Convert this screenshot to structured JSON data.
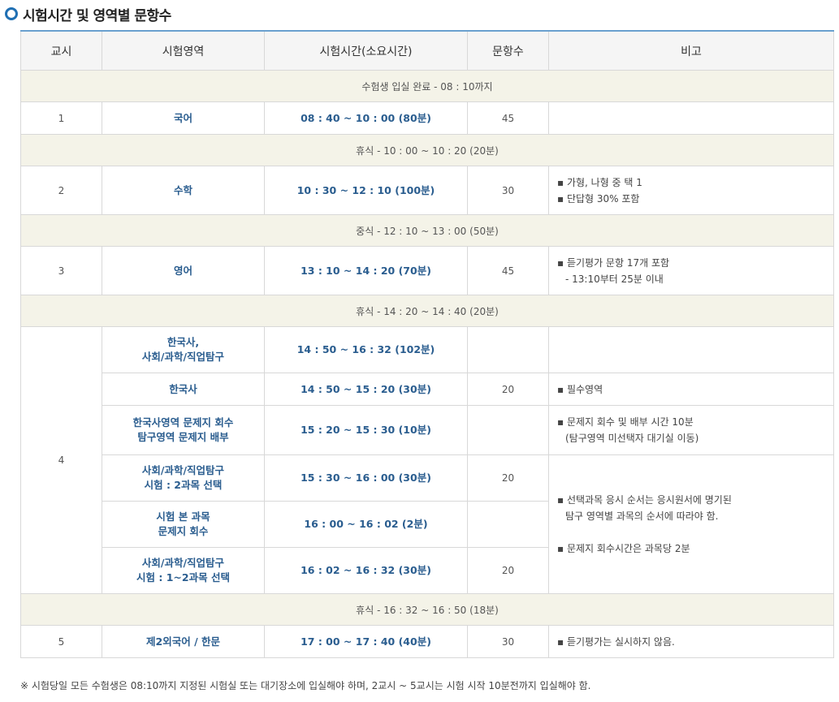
{
  "title": "시험시간 및 영역별 문항수",
  "columns": [
    "교시",
    "시험영역",
    "시험시간(소요시간)",
    "문항수",
    "비고"
  ],
  "breaks": {
    "entry": "수험생 입실 완료 - 08 : 10까지",
    "rest1": "휴식 - 10 : 00 ~ 10 : 20 (20분)",
    "lunch": "중식 - 12 : 10 ~ 13 : 00 (50분)",
    "rest2": "휴식 - 14 : 20 ~ 14 : 40 (20분)",
    "rest3": "휴식 - 16 : 32 ~ 16 : 50 (18분)"
  },
  "p1": {
    "period": "1",
    "subject": "국어",
    "time": "08 : 40 ~ 10 : 00 (80분)",
    "count": "45"
  },
  "p2": {
    "period": "2",
    "subject": "수학",
    "time": "10 : 30 ~ 12 : 10 (100분)",
    "count": "30",
    "note1": "▪ 가형, 나형 중 택 1",
    "note2": "▪ 단답형 30% 포함"
  },
  "p3": {
    "period": "3",
    "subject": "영어",
    "time": "13 : 10 ~ 14 : 20 (70분)",
    "count": "45",
    "note1": "▪ 듣기평가 문항 17개 포함",
    "note2": "- 13:10부터 25분 이내"
  },
  "p4": {
    "period": "4",
    "r1": {
      "subject1": "한국사,",
      "subject2": "사회/과학/직업탐구",
      "time": "14 : 50 ~ 16 : 32 (102분)"
    },
    "r2": {
      "subject": "한국사",
      "time": "14 : 50 ~ 15 : 20 (30분)",
      "count": "20",
      "note": "▪ 필수영역"
    },
    "r3": {
      "subject1": "한국사영역 문제지 회수",
      "subject2": "탐구영역 문제지 배부",
      "time": "15 : 20 ~ 15 : 30 (10분)",
      "note1": "▪ 문제지 회수 및 배부 시간 10분",
      "note2": "(탐구영역 미선택자 대기실 이동)"
    },
    "r4": {
      "subject1": "사회/과학/직업탐구",
      "subject2": "시험 : 2과목 선택",
      "time": "15 : 30 ~ 16 : 00 (30분)",
      "count": "20",
      "note1": "▪ 선택과목 응시 순서는 응시원서에 명기된",
      "note2": "탐구 영역별 과목의 순서에 따라야 함.",
      "note3": "▪ 문제지 회수시간은 과목당 2분"
    },
    "r5": {
      "subject1": "시험 본 과목",
      "subject2": "문제지 회수",
      "time": "16 : 00 ~ 16 : 02 (2분)"
    },
    "r6": {
      "subject1": "사회/과학/직업탐구",
      "subject2": "시험 : 1~2과목 선택",
      "time": "16 : 02 ~ 16 : 32 (30분)",
      "count": "20"
    }
  },
  "p5": {
    "period": "5",
    "subject": "제2외국어 / 한문",
    "time": "17 : 00 ~ 17 : 40 (40분)",
    "count": "30",
    "note": "▪ 듣기평가는 실시하지 않음."
  },
  "footer": "※ 시험당일 모든 수험생은 08:10까지 지정된 시험실 또는 대기장소에 입실해야 하며, 2교시 ~ 5교시는 시험 시작 10분전까지 입실해야 함.",
  "colors": {
    "accent": "#1f6fb3",
    "subject_text": "#2a5d8f",
    "break_bg": "#f4f3e8",
    "header_bg": "#f5f5f5"
  }
}
